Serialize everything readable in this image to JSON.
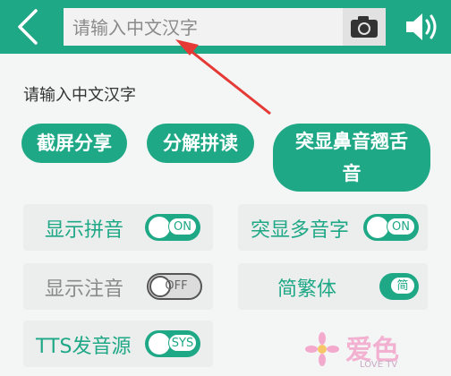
{
  "search": {
    "placeholder": "请输入中文汉字"
  },
  "hint_text": "请输入中文汉字",
  "buttons": {
    "screenshot_share": "截屏分享",
    "split_pinyin": "分解拼读",
    "highlight_line1": "突显鼻音翘舌",
    "highlight_line2": "音"
  },
  "settings": [
    {
      "label": "显示拼音",
      "state": "ON",
      "enabled": true
    },
    {
      "label": "突显多音字",
      "state": "ON",
      "enabled": true
    },
    {
      "label": "显示注音",
      "state": "OFF",
      "enabled": false
    },
    {
      "label": "简繁体",
      "state": "简",
      "enabled": true
    },
    {
      "label": "TTS发音源",
      "state": "SYS",
      "enabled": true
    }
  ],
  "watermark": {
    "text": "爱色",
    "sub": "LOVE TV"
  },
  "colors": {
    "accent": "#1fa886",
    "arrow": "#e53935",
    "disabled_text": "#8a8a8a"
  },
  "icons": [
    "back-chevron-icon",
    "camera-icon",
    "speaker-icon"
  ]
}
